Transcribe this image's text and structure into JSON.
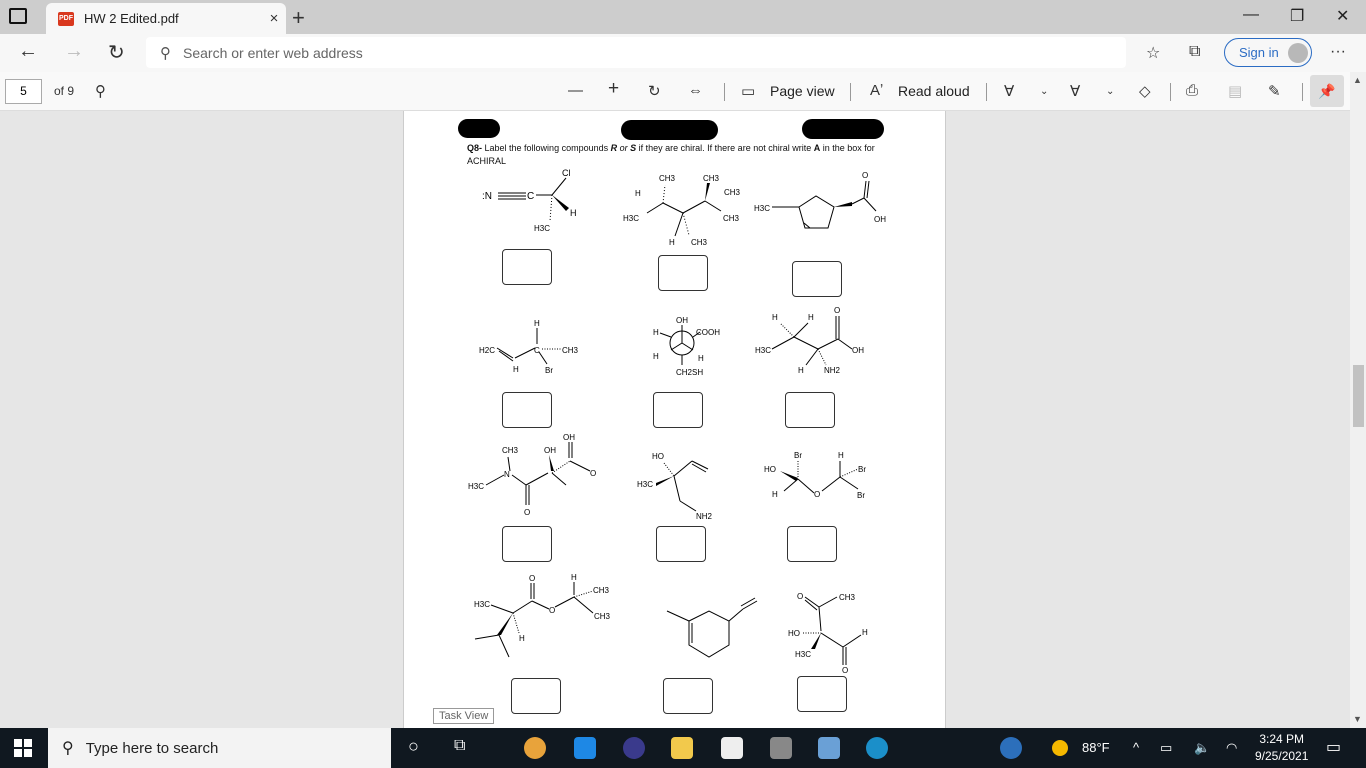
{
  "window": {
    "tab_title": "HW 2 Edited.pdf",
    "tab_close": "×",
    "new_tab": "+",
    "minimize": "—",
    "restore": "❐",
    "close": "✕"
  },
  "navbar": {
    "back": "←",
    "forward": "→",
    "refresh": "↻",
    "address_placeholder": "Search or enter web address",
    "sign_in": "Sign in",
    "more": "···"
  },
  "pdf_toolbar": {
    "page_number": "5",
    "page_count": "of 9",
    "zoom_out": "—",
    "zoom_in": "+",
    "page_view": "Page view",
    "read_aloud": "Read aloud"
  },
  "document": {
    "question_label": "Q8-",
    "question_text": " Label the following compounds ",
    "r": "R",
    "or": " or ",
    "s": "S",
    "question_rest": " if they are chiral. If there are not chiral write ",
    "a": "A",
    "question_end": " in the box for ACHIRAL",
    "labels": {
      "cl": "Cl",
      "n": ":N",
      "c": "C",
      "h": "H",
      "h3c": "H3C",
      "ch3": "CH3",
      "oh": "OH",
      "o": "O",
      "br": "Br",
      "cooh": "COOH",
      "ch2sh": "CH2SH",
      "nh2": "NH2",
      "ho": "HO",
      "h2c": "H2C",
      "n_atom": "N"
    }
  },
  "tooltip": "Task View",
  "taskbar": {
    "search_placeholder": "Type here to search",
    "weather": "88°F",
    "time": "3:24 PM",
    "date": "9/25/2021"
  }
}
